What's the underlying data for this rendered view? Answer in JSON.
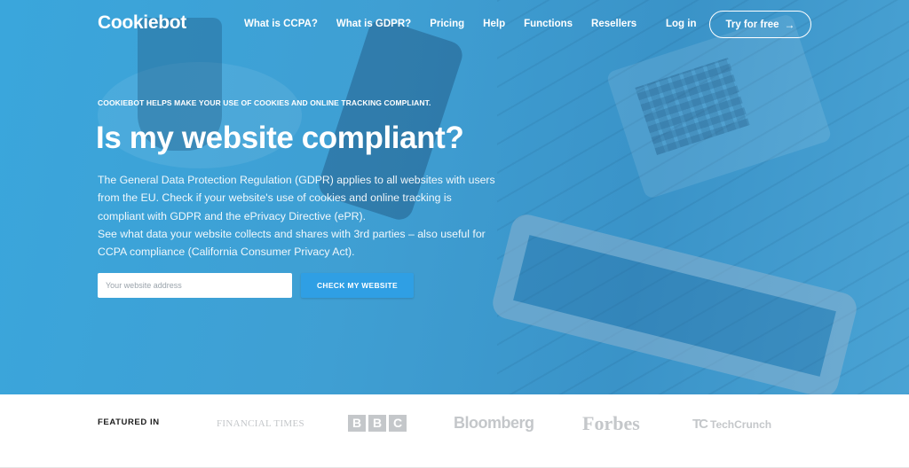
{
  "brand": {
    "logo": "Cookiebot"
  },
  "nav": {
    "links": [
      "What is CCPA?",
      "What is GDPR?",
      "Pricing",
      "Help",
      "Functions",
      "Resellers"
    ],
    "login": "Log in",
    "cta": "Try for free",
    "cta_icon": "arrow-right-icon"
  },
  "hero": {
    "eyebrow": "COOKIEBOT HELPS MAKE YOUR USE OF COOKIES AND ONLINE TRACKING COMPLIANT.",
    "headline": "Is my website compliant?",
    "paragraph_1": "The General Data Protection Regulation (GDPR) applies to all websites with users from the EU. Check if your website's use of cookies and online tracking is compliant with GDPR and the ePrivacy Directive (ePR).",
    "paragraph_2": "See what data your website collects and shares with 3rd parties – also useful for CCPA compliance (California Consumer Privacy Act).",
    "input_placeholder": "Your website address",
    "input_value": "",
    "button": "CHECK MY WEBSITE"
  },
  "featured": {
    "label": "FEATURED IN",
    "publications": {
      "ft": "FINANCIAL TIMES",
      "bbc": [
        "B",
        "B",
        "C"
      ],
      "bloomberg": "Bloomberg",
      "forbes": "Forbes",
      "techcrunch_mark": "TC",
      "techcrunch": "TechCrunch"
    }
  },
  "colors": {
    "hero_blue": "#3f9fd3",
    "button_blue": "#2f9fe4",
    "logo_gray": "#c4c7ca"
  }
}
